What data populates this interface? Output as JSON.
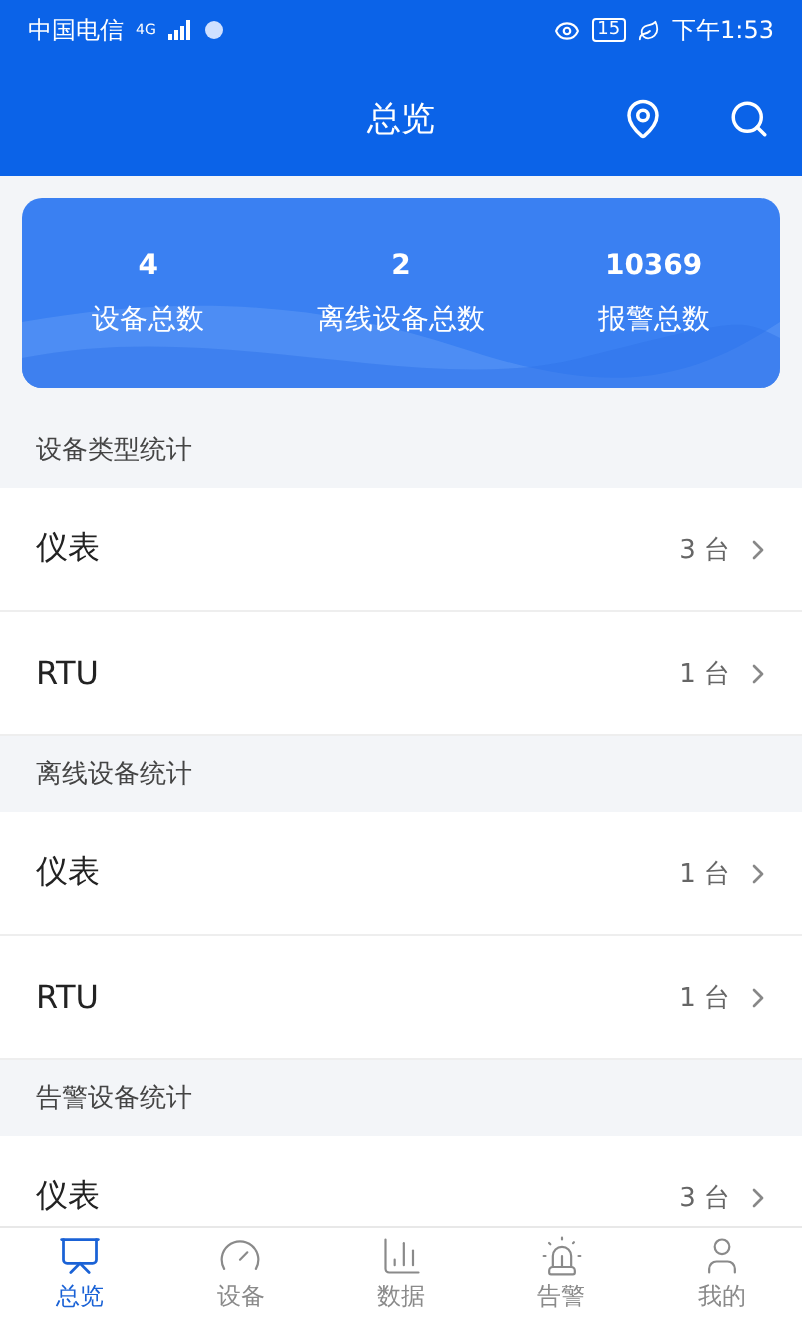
{
  "status_bar": {
    "carrier": "中国电信",
    "network": "4G",
    "battery": "15",
    "time": "下午1:53"
  },
  "header": {
    "title": "总览"
  },
  "summary": [
    {
      "value": "4",
      "label": "设备总数"
    },
    {
      "value": "2",
      "label": "离线设备总数"
    },
    {
      "value": "10369",
      "label": "报警总数"
    }
  ],
  "sections": [
    {
      "title": "设备类型统计",
      "rows": [
        {
          "name": "仪表",
          "count": "3 台"
        },
        {
          "name": "RTU",
          "count": "1 台"
        }
      ]
    },
    {
      "title": "离线设备统计",
      "rows": [
        {
          "name": "仪表",
          "count": "1 台"
        },
        {
          "name": "RTU",
          "count": "1 台"
        }
      ]
    },
    {
      "title": "告警设备统计",
      "rows": [
        {
          "name": "仪表",
          "count": "3 台"
        }
      ]
    }
  ],
  "tab_bar": [
    {
      "kind": "overview",
      "label": "总览",
      "selected": true
    },
    {
      "kind": "device",
      "label": "设备",
      "selected": false
    },
    {
      "kind": "data",
      "label": "数据",
      "selected": false
    },
    {
      "kind": "alarm",
      "label": "告警",
      "selected": false
    },
    {
      "kind": "profile",
      "label": "我的",
      "selected": false
    }
  ]
}
